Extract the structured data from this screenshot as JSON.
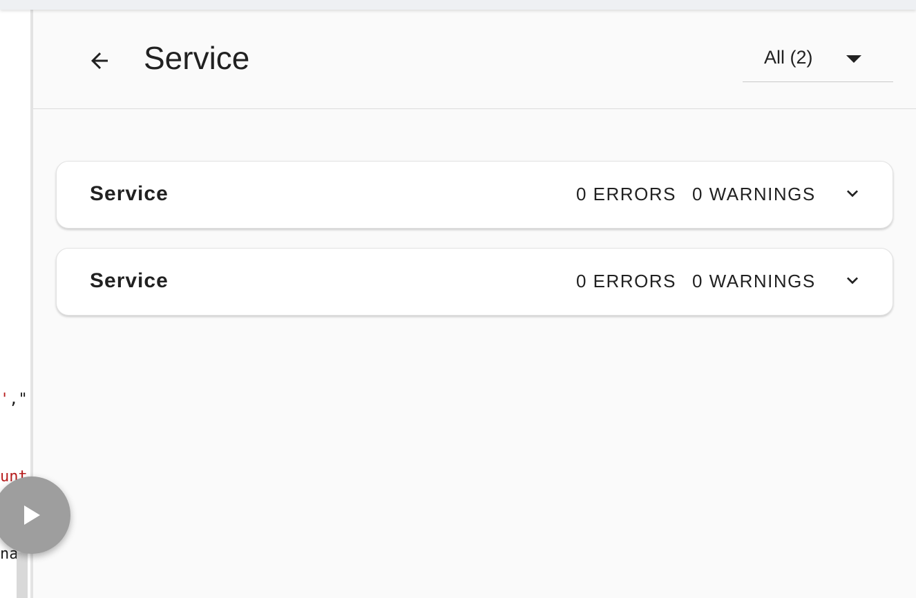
{
  "editor": {
    "line1_red": "'",
    "line1_rest": ",\"",
    "line2": "unt",
    "line3": "nalle"
  },
  "header": {
    "title": "Service",
    "filter": {
      "selected": "All (2)"
    }
  },
  "cards": [
    {
      "title": "Service",
      "errors": "0 ERRORS",
      "warnings": "0 WARNINGS"
    },
    {
      "title": "Service",
      "errors": "0 ERRORS",
      "warnings": "0 WARNINGS"
    }
  ],
  "icons": {
    "back": "arrow-back-icon",
    "filter_caret": "caret-down-icon",
    "expand": "chevron-down-icon",
    "play": "play-icon"
  },
  "colors": {
    "background": "#fafafa",
    "card": "#ffffff",
    "text": "#212121",
    "code_red": "#b71c1c",
    "play_button": "#9e9e9e"
  }
}
